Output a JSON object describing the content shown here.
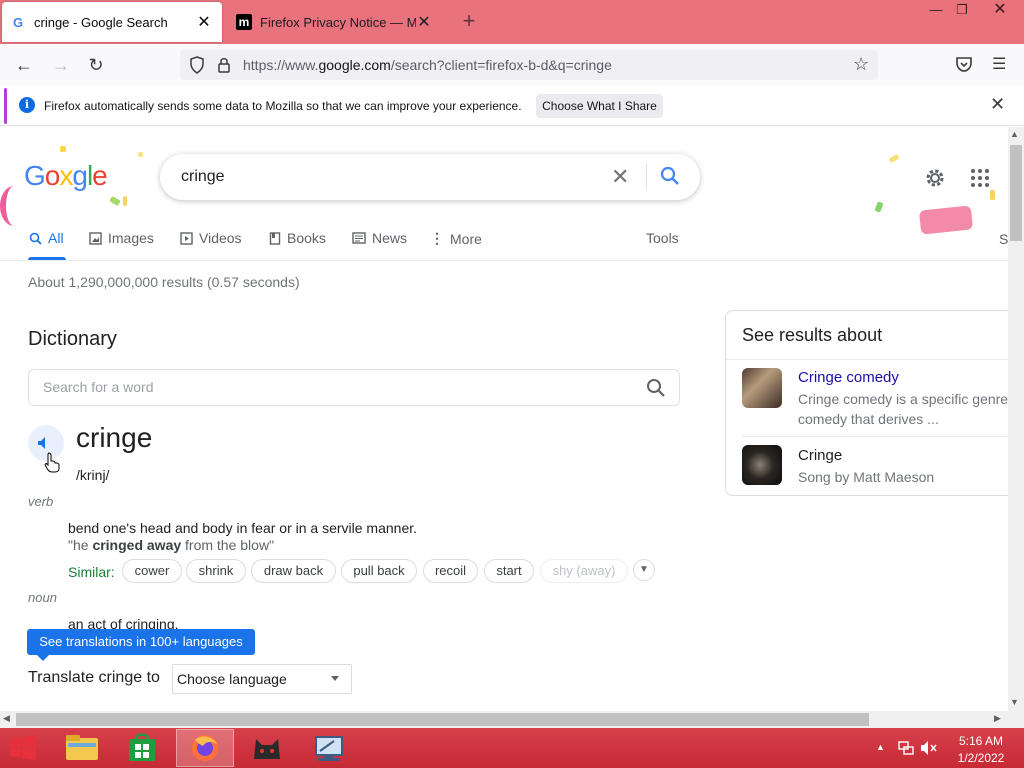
{
  "browser": {
    "tabs": [
      {
        "title": "cringe - Google Search",
        "favicon": "google-g-icon",
        "active": true
      },
      {
        "title": "Firefox Privacy Notice — Mozilla",
        "favicon": "mozilla-m-icon",
        "active": false
      }
    ],
    "new_tab_icon": "plus-icon",
    "window_controls": [
      "minimize-icon",
      "restore-icon",
      "close-icon"
    ],
    "url_prefix": "https://www.",
    "url_domain": "google.com",
    "url_rest": "/search?client=firefox-b-d&q=cringe"
  },
  "notification": {
    "text": "Firefox automatically sends some data to Mozilla so that we can improve your experience.",
    "button": "Choose What I Share",
    "color": "#b53ddc"
  },
  "google": {
    "query": "cringe",
    "tabs": {
      "all": "All",
      "images": "Images",
      "videos": "Videos",
      "books": "Books",
      "news": "News",
      "more": "More",
      "tools": "Tools"
    },
    "stats": "About 1,290,000,000 results (0.57 seconds)",
    "accent": "#1a73e8"
  },
  "dictionary": {
    "title": "Dictionary",
    "search_placeholder": "Search for a word",
    "word": "cringe",
    "phonetic": "/krinj/",
    "pos1": "verb",
    "def1": "bend one's head and body in fear or in a servile manner.",
    "ex1_pre": "\"he ",
    "ex1_bold": "cringed away",
    "ex1_post": " from the blow\"",
    "similar_label": "Similar:",
    "similar": [
      "cower",
      "shrink",
      "draw back",
      "pull back",
      "recoil",
      "start",
      "shy (away)"
    ],
    "pos2": "noun",
    "def2": "an act of cringing.",
    "translations_button": "See translations in 100+ languages",
    "translate_label": "Translate cringe to",
    "language_select": "Choose language"
  },
  "knowledge_panel": {
    "title": "See results about",
    "items": [
      {
        "name": "Cringe comedy",
        "desc1": "Cringe comedy is a specific genre of",
        "desc2": "comedy that derives ..."
      },
      {
        "name": "Cringe",
        "desc": "Song by Matt Maeson"
      }
    ]
  },
  "taskbar": {
    "time": "5:16 AM",
    "date": "1/2/2022",
    "color": "#c52a35"
  }
}
